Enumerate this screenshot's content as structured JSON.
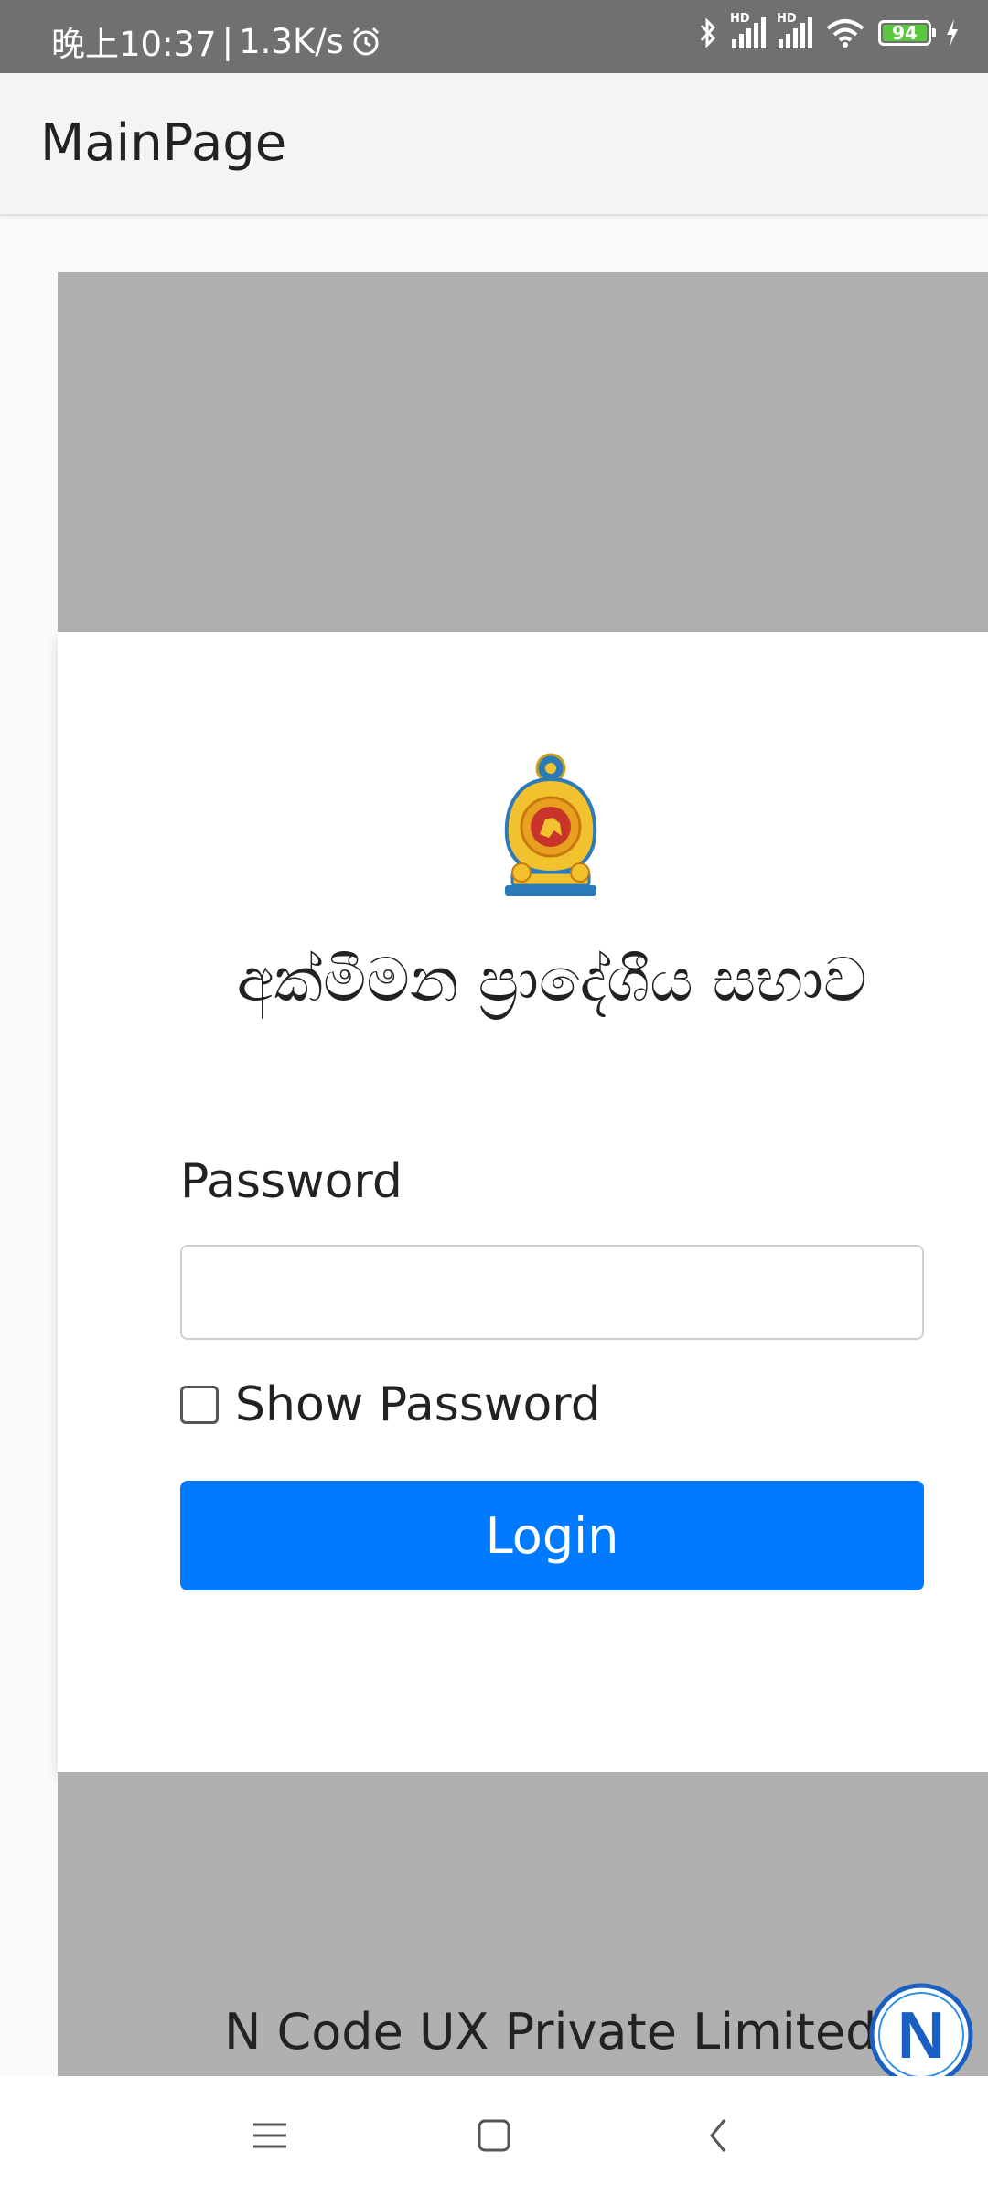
{
  "status_bar": {
    "time": "晚上10:37",
    "separator": "|",
    "net_speed": "1.3K/s",
    "signal_label_1": "HD",
    "signal_label_2": "HD",
    "battery": "94",
    "icons": [
      "alarm-icon",
      "bluetooth-icon",
      "signal-icon",
      "wifi-icon",
      "battery-icon",
      "charging-icon"
    ]
  },
  "app_bar": {
    "title": "MainPage"
  },
  "login_card": {
    "org_title": "අක්මීමන ප්‍රාදේශීය සභාව",
    "password_label": "Password",
    "password_value": "",
    "password_placeholder": "",
    "show_password_label": "Show Password",
    "show_password_checked": false,
    "login_button": "Login",
    "button_color": "#007bff"
  },
  "footer": {
    "company": "N Code UX Private Limited",
    "logo_letter": "N"
  },
  "nav_bar": {
    "icons": [
      "menu-icon",
      "home-icon",
      "back-icon"
    ]
  },
  "colors": {
    "status_bar": "#707070",
    "hero_gray": "#b0b0b0",
    "accent": "#007bff",
    "battery_green": "#5ac73f"
  }
}
